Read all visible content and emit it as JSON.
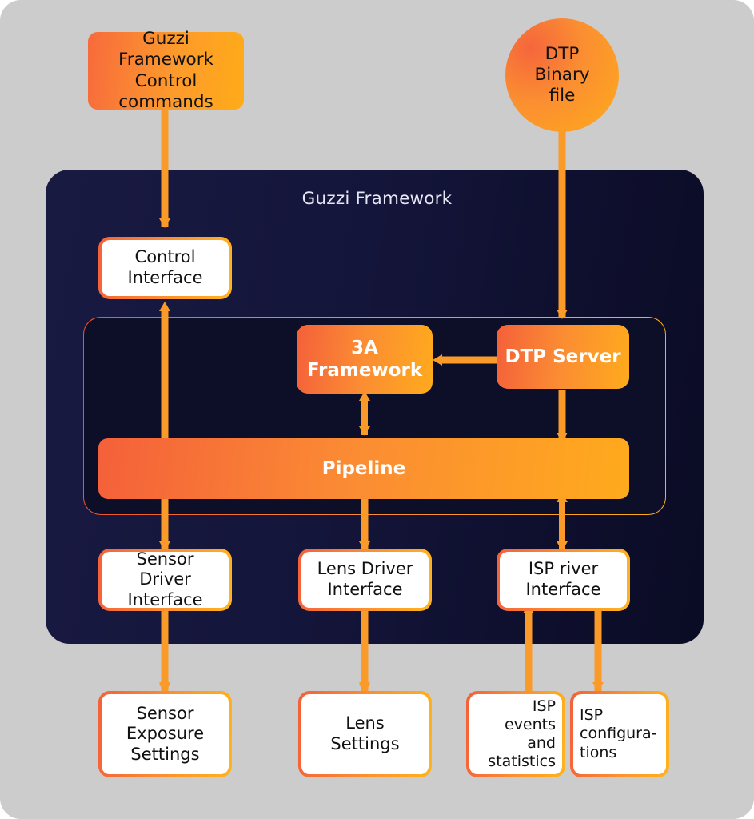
{
  "diagram": {
    "title": "Guzzi Framework",
    "background_color": "#cccccc",
    "panel_color": "#14153a",
    "accent_orange": "#fb8c33",
    "accent_red_orange": "#f4603a",
    "accent_amber": "#ffaa1d"
  },
  "sources": [
    {
      "id": "guzzi-commands",
      "label_line1": "Guzzi Framework",
      "label_line2": "Control commands"
    },
    {
      "id": "dtp-binary",
      "label_line1": "DTP",
      "label_line2": "Binary",
      "label_line3": "file"
    }
  ],
  "panel": {
    "title": "Guzzi Framework",
    "nodes": [
      {
        "id": "control-interface",
        "label_line1": "Control",
        "label_line2": "Interface",
        "style": "white"
      },
      {
        "id": "3a-framework",
        "label_line1": "3A",
        "label_line2": "Framework",
        "style": "orange"
      },
      {
        "id": "dtp-server",
        "label_line1": "DTP Server",
        "style": "orange"
      },
      {
        "id": "pipeline",
        "label_line1": "Pipeline",
        "style": "orange"
      },
      {
        "id": "sensor-driver-interface",
        "label_line1": "Sensor Driver",
        "label_line2": "Interface",
        "style": "white"
      },
      {
        "id": "lens-driver-interface",
        "label_line1": "Lens Driver",
        "label_line2": "Interface",
        "style": "white"
      },
      {
        "id": "isp-river-interface",
        "label_line1": "ISP river",
        "label_line2": "Interface",
        "style": "white"
      }
    ]
  },
  "outputs": [
    {
      "id": "sensor-exposure-settings",
      "label_line1": "Sensor",
      "label_line2": "Exposure",
      "label_line3": "Settings",
      "align": "center"
    },
    {
      "id": "lens-settings",
      "label_line1": "Lens",
      "label_line2": "Settings",
      "align": "center"
    },
    {
      "id": "isp-events-and-statistics",
      "label_line1": "ISP",
      "label_line2": "events and",
      "label_line3": "statistics",
      "align": "right"
    },
    {
      "id": "isp-configurations",
      "label_line1": "ISP",
      "label_line2": "configura-",
      "label_line3": "tions",
      "align": "left"
    }
  ],
  "connections": [
    {
      "id": "commands-to-control",
      "from": "guzzi-commands",
      "to": "control-interface",
      "direction": "down"
    },
    {
      "id": "dtp-binary-to-dtp-server",
      "from": "dtp-binary",
      "to": "dtp-server",
      "direction": "down"
    },
    {
      "id": "control-to-pipeline",
      "from": "pipeline",
      "to": "control-interface",
      "direction": "up"
    },
    {
      "id": "dtp-server-to-3a",
      "from": "dtp-server",
      "to": "3a-framework",
      "direction": "left"
    },
    {
      "id": "3a-to-pipeline",
      "from": "3a-framework",
      "to": "pipeline",
      "direction": "both"
    },
    {
      "id": "dtp-server-to-pipeline",
      "from": "dtp-server",
      "to": "pipeline",
      "direction": "down"
    },
    {
      "id": "pipeline-to-sensor-driver",
      "from": "pipeline",
      "to": "sensor-driver-interface",
      "direction": "down"
    },
    {
      "id": "pipeline-to-lens-driver",
      "from": "pipeline",
      "to": "lens-driver-interface",
      "direction": "down"
    },
    {
      "id": "pipeline-to-isp-river",
      "from": "pipeline",
      "to": "isp-river-interface",
      "direction": "both"
    },
    {
      "id": "sensor-driver-to-exposure",
      "from": "sensor-driver-interface",
      "to": "sensor-exposure-settings",
      "direction": "down"
    },
    {
      "id": "lens-driver-to-settings",
      "from": "lens-driver-interface",
      "to": "lens-settings",
      "direction": "down"
    },
    {
      "id": "isp-events-to-river",
      "from": "isp-events-and-statistics",
      "to": "isp-river-interface",
      "direction": "up"
    },
    {
      "id": "isp-river-to-configurations",
      "from": "isp-river-interface",
      "to": "isp-configurations",
      "direction": "down"
    }
  ]
}
